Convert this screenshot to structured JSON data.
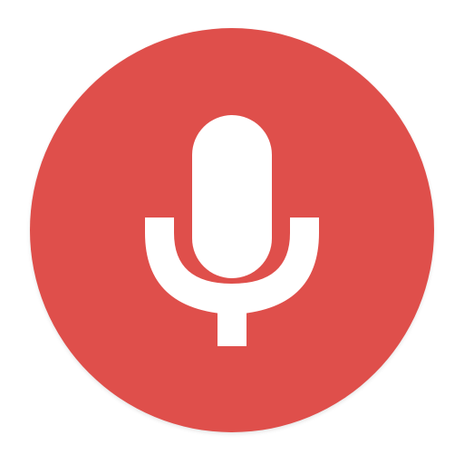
{
  "mic_button": {
    "icon": "microphone-icon",
    "background_color": "#df4f4b",
    "icon_color": "#ffffff"
  }
}
